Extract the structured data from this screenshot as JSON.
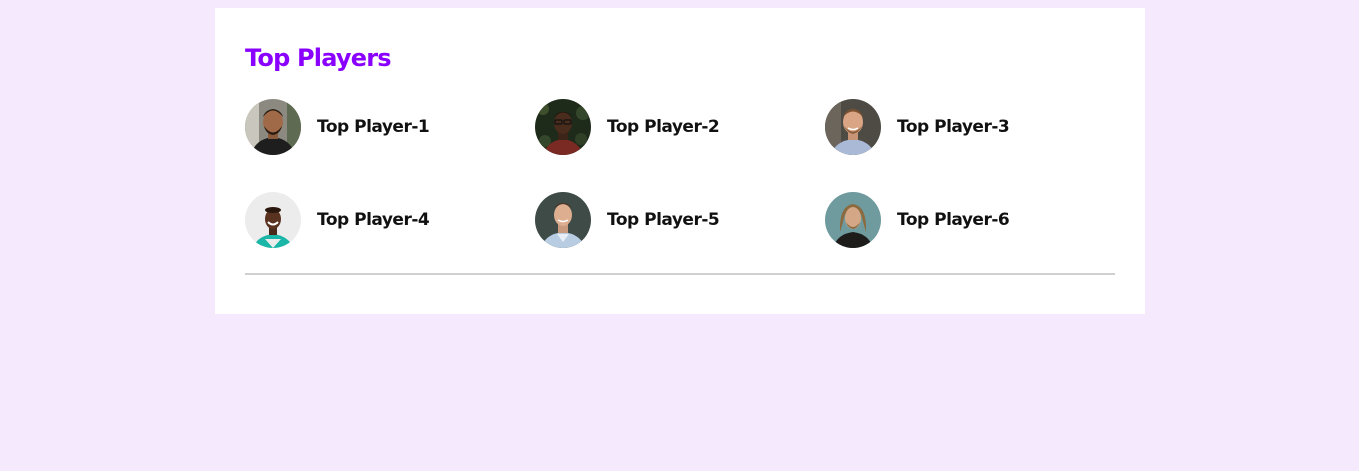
{
  "section": {
    "title": "Top Players"
  },
  "players": [
    {
      "name": "Top Player-1",
      "avatar": "person-avatar-icon"
    },
    {
      "name": "Top Player-2",
      "avatar": "person-avatar-icon"
    },
    {
      "name": "Top Player-3",
      "avatar": "person-avatar-icon"
    },
    {
      "name": "Top Player-4",
      "avatar": "person-avatar-icon"
    },
    {
      "name": "Top Player-5",
      "avatar": "person-avatar-icon"
    },
    {
      "name": "Top Player-6",
      "avatar": "person-avatar-icon"
    }
  ],
  "colors": {
    "page_background": "#f5e9fd",
    "card_background": "#ffffff",
    "title": "#8a00ff",
    "player_name": "#111111",
    "divider": "#d0d0d0"
  }
}
